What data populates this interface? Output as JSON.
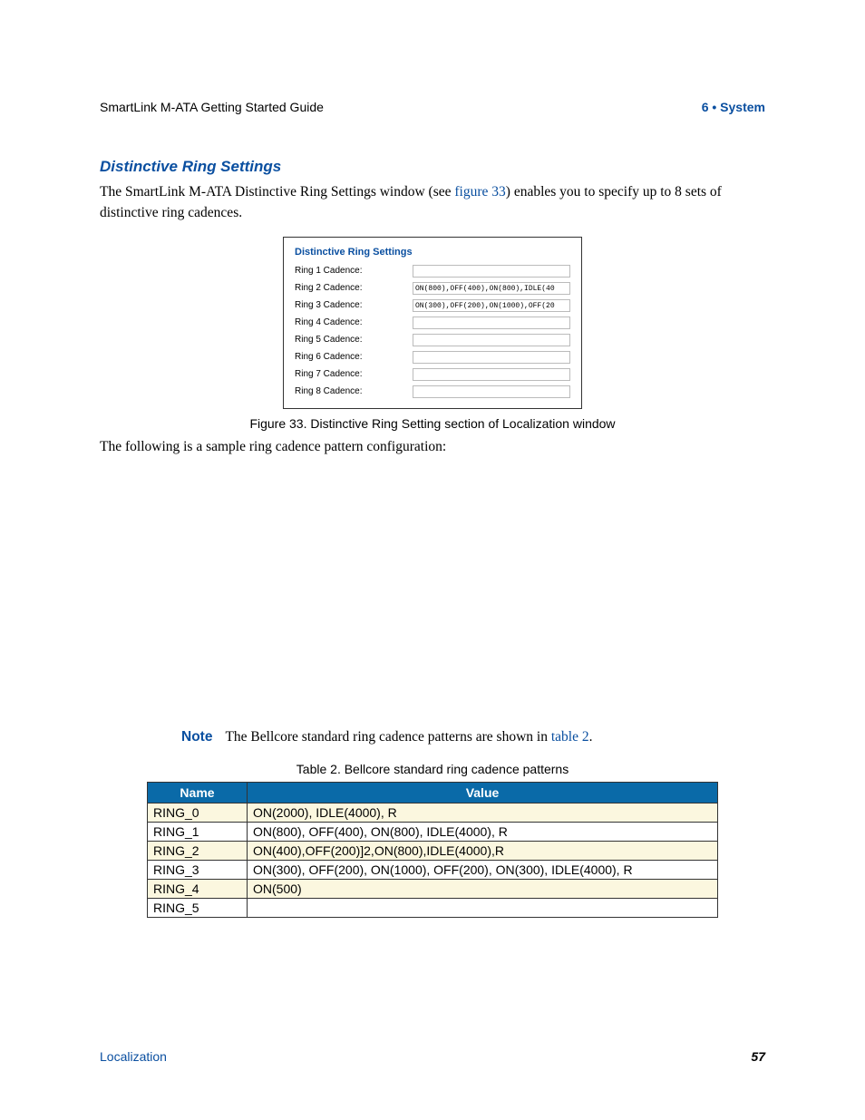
{
  "header": {
    "left": "SmartLink M-ATA Getting Started Guide",
    "right": "6 • System"
  },
  "section": {
    "title": "Distinctive Ring Settings",
    "intro_part1": "The SmartLink M-ATA Distinctive Ring Settings window (see ",
    "intro_link": "figure 33",
    "intro_part2": ") enables you to specify up to 8 sets of distinctive ring cadences."
  },
  "panel": {
    "title": "Distinctive Ring Settings",
    "rows": [
      {
        "label": "Ring 1 Cadence:",
        "value": ""
      },
      {
        "label": "Ring 2 Cadence:",
        "value": "ON(800),OFF(400),ON(800),IDLE(40"
      },
      {
        "label": "Ring 3 Cadence:",
        "value": "ON(300),OFF(200),ON(1000),OFF(20"
      },
      {
        "label": "Ring 4 Cadence:",
        "value": ""
      },
      {
        "label": "Ring 5 Cadence:",
        "value": ""
      },
      {
        "label": "Ring 6 Cadence:",
        "value": ""
      },
      {
        "label": "Ring 7 Cadence:",
        "value": ""
      },
      {
        "label": "Ring 8 Cadence:",
        "value": ""
      }
    ]
  },
  "figure_caption": "Figure 33. Distinctive Ring Setting section of Localization window",
  "sample_text": "The following is a sample ring cadence pattern configuration:",
  "note": {
    "label": "Note",
    "text_part1": "The Bellcore standard ring cadence patterns are shown in ",
    "link": "table 2",
    "text_part2": "."
  },
  "table": {
    "caption": "Table 2. Bellcore standard ring cadence patterns",
    "headers": [
      "Name",
      "Value"
    ],
    "rows": [
      {
        "name": "RING_0",
        "value": "ON(2000), IDLE(4000), R",
        "alt": true
      },
      {
        "name": "RING_1",
        "value": "ON(800), OFF(400), ON(800), IDLE(4000), R",
        "alt": false
      },
      {
        "name": "RING_2",
        "value": "ON(400),OFF(200)]2,ON(800),IDLE(4000),R",
        "alt": true
      },
      {
        "name": "RING_3",
        "value": "ON(300), OFF(200), ON(1000), OFF(200), ON(300), IDLE(4000), R",
        "alt": false
      },
      {
        "name": "RING_4",
        "value": "ON(500)",
        "alt": true
      },
      {
        "name": "RING_5",
        "value": "",
        "alt": false
      }
    ]
  },
  "footer": {
    "left": "Localization",
    "right": "57"
  }
}
